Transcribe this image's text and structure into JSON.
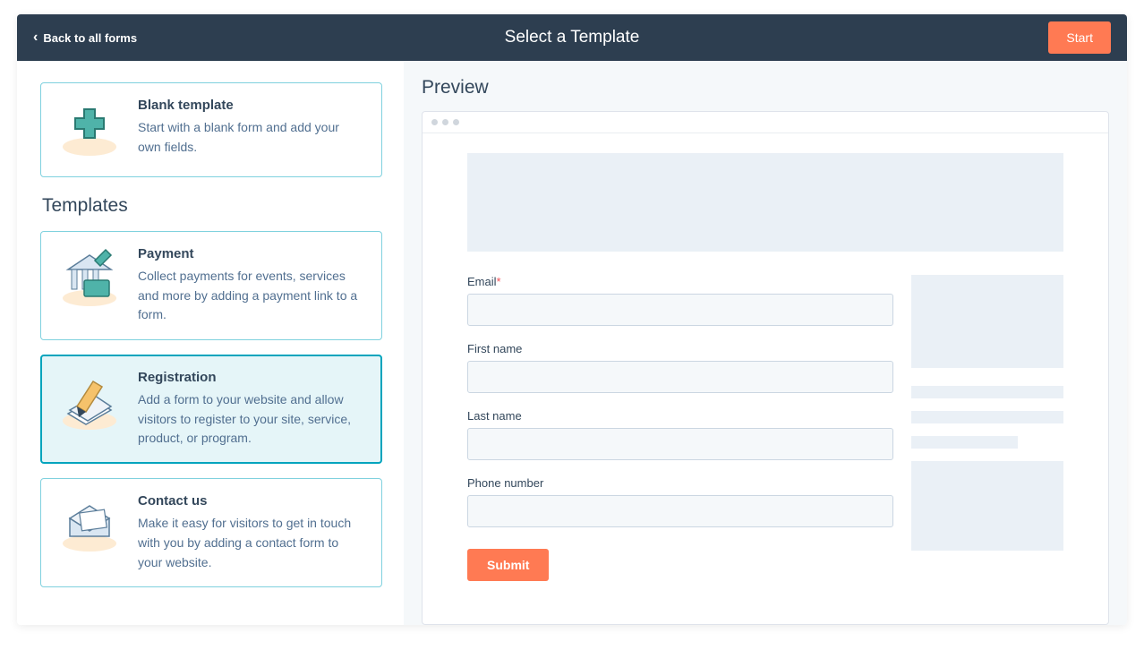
{
  "header": {
    "back_label": "Back to all forms",
    "title": "Select a Template",
    "start_label": "Start"
  },
  "sidebar": {
    "blank": {
      "title": "Blank template",
      "desc": "Start with a blank form and add your own fields."
    },
    "section_title": "Templates",
    "templates": [
      {
        "title": "Payment",
        "desc": "Collect payments for events, services and more by adding a payment link to a form.",
        "selected": false
      },
      {
        "title": "Registration",
        "desc": "Add a form to your website and allow visitors to register to your site, service, product, or program.",
        "selected": true
      },
      {
        "title": "Contact us",
        "desc": "Make it easy for visitors to get in touch with you by adding a contact form to your website.",
        "selected": false
      }
    ]
  },
  "preview": {
    "title": "Preview",
    "fields": [
      {
        "label": "Email",
        "required": true
      },
      {
        "label": "First name",
        "required": false
      },
      {
        "label": "Last name",
        "required": false
      },
      {
        "label": "Phone number",
        "required": false
      }
    ],
    "submit_label": "Submit"
  }
}
